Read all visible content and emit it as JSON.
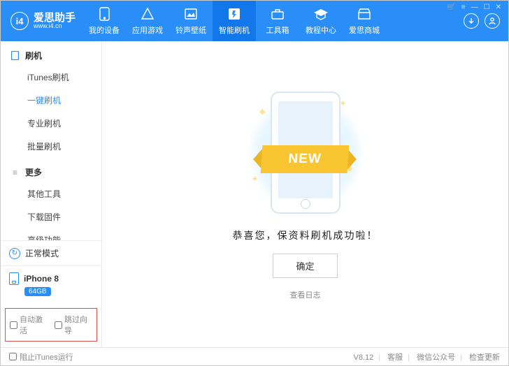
{
  "brand": {
    "logo_text": "i4",
    "title": "爱思助手",
    "url": "www.i4.cn"
  },
  "nav": [
    {
      "id": "devices",
      "label": "我的设备",
      "active": false
    },
    {
      "id": "games",
      "label": "应用游戏",
      "active": false
    },
    {
      "id": "rings",
      "label": "铃声壁纸",
      "active": false
    },
    {
      "id": "flash",
      "label": "智能刷机",
      "active": true
    },
    {
      "id": "tools",
      "label": "工具箱",
      "active": false
    },
    {
      "id": "tutor",
      "label": "教程中心",
      "active": false
    },
    {
      "id": "mall",
      "label": "爱思商城",
      "active": false
    }
  ],
  "sidebar": {
    "group1": {
      "title": "刷机",
      "items": [
        "iTunes刷机",
        "一键刷机",
        "专业刷机",
        "批量刷机"
      ],
      "active_index": 1
    },
    "group2": {
      "title": "更多",
      "items": [
        "其他工具",
        "下载固件",
        "高级功能"
      ],
      "active_index": -1
    },
    "mode": "正常模式",
    "device_name": "iPhone 8",
    "device_storage": "64GB",
    "auto_activate": "自动激活",
    "skip_wizard": "跳过向导"
  },
  "main": {
    "banner": "NEW",
    "message": "恭喜您，保资料刷机成功啦！",
    "confirm": "确定",
    "view_logs": "查看日志"
  },
  "footer": {
    "block_itunes": "阻止iTunes运行",
    "version": "V8.12",
    "kefu": "客服",
    "wechat": "微信公众号",
    "update": "检查更新"
  }
}
